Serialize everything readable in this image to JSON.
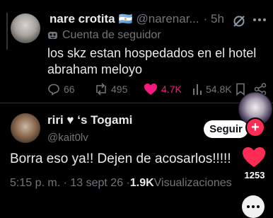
{
  "tweet1": {
    "display_name": "nare crotita",
    "flag_emoji": "🇦🇷",
    "handle": "@narenar...",
    "time": "· 5h",
    "follower_label": "Cuenta de seguidor",
    "text_line1": "los skz estan hospedados en el hotel",
    "text_line2": "abraham meloyo",
    "replies": "66",
    "reposts": "495",
    "likes": "4.7K",
    "views": "54.8K"
  },
  "tweet2": {
    "display_name": "riri ♥ ‘s Togami",
    "handle": "@kait0lv",
    "text": "Borra eso ya!! Dejen de acosarlos!!!!!",
    "timestamp": "5:15 p. m. · 13 sept 26 · ",
    "views_count": "1.9K",
    "views_label": " Visualizaciones"
  },
  "overlay": {
    "follow_label": "Seguir",
    "plus": "+",
    "like_count": "1253"
  },
  "colors": {
    "like_pink": "#f91880",
    "overlay_heart": "#fe2c55",
    "muted": "#71767b"
  }
}
